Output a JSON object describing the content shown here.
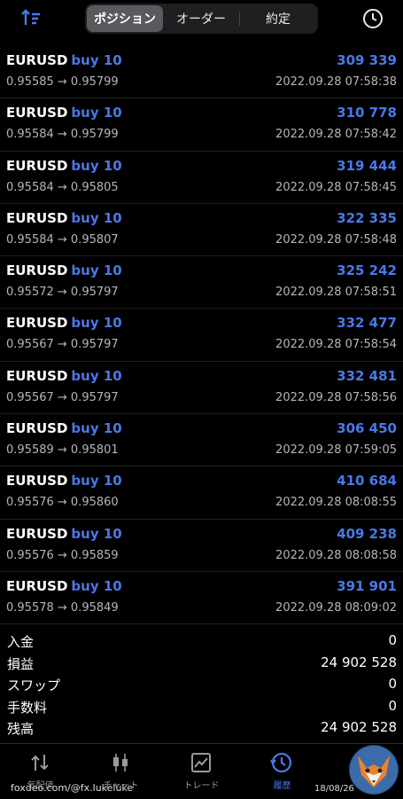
{
  "tabs": [
    {
      "label": "ポジション",
      "active": true
    },
    {
      "label": "オーダー",
      "active": false
    },
    {
      "label": "約定",
      "active": false
    }
  ],
  "icons": {
    "sort": "sort-arrows-icon",
    "history": "clock-icon"
  },
  "colors": {
    "accent": "#4a78e8",
    "background": "#000000"
  },
  "deals": [
    {
      "symbol": "EURUSD",
      "side": "buy 10",
      "profit": "309 339",
      "prices": "0.95585 → 0.95799",
      "time": "2022.09.28 07:58:38"
    },
    {
      "symbol": "EURUSD",
      "side": "buy 10",
      "profit": "310 778",
      "prices": "0.95584 → 0.95799",
      "time": "2022.09.28 07:58:42"
    },
    {
      "symbol": "EURUSD",
      "side": "buy 10",
      "profit": "319 444",
      "prices": "0.95584 → 0.95805",
      "time": "2022.09.28 07:58:45"
    },
    {
      "symbol": "EURUSD",
      "side": "buy 10",
      "profit": "322 335",
      "prices": "0.95584 → 0.95807",
      "time": "2022.09.28 07:58:48"
    },
    {
      "symbol": "EURUSD",
      "side": "buy 10",
      "profit": "325 242",
      "prices": "0.95572 → 0.95797",
      "time": "2022.09.28 07:58:51"
    },
    {
      "symbol": "EURUSD",
      "side": "buy 10",
      "profit": "332 477",
      "prices": "0.95567 → 0.95797",
      "time": "2022.09.28 07:58:54"
    },
    {
      "symbol": "EURUSD",
      "side": "buy 10",
      "profit": "332 481",
      "prices": "0.95567 → 0.95797",
      "time": "2022.09.28 07:58:56"
    },
    {
      "symbol": "EURUSD",
      "side": "buy 10",
      "profit": "306 450",
      "prices": "0.95589 → 0.95801",
      "time": "2022.09.28 07:59:05"
    },
    {
      "symbol": "EURUSD",
      "side": "buy 10",
      "profit": "410 684",
      "prices": "0.95576 → 0.95860",
      "time": "2022.09.28 08:08:55"
    },
    {
      "symbol": "EURUSD",
      "side": "buy 10",
      "profit": "409 238",
      "prices": "0.95576 → 0.95859",
      "time": "2022.09.28 08:08:58"
    },
    {
      "symbol": "EURUSD",
      "side": "buy 10",
      "profit": "391 901",
      "prices": "0.95578 → 0.95849",
      "time": "2022.09.28 08:09:02"
    }
  ],
  "summary": [
    {
      "label": "入金",
      "value": "0"
    },
    {
      "label": "損益",
      "value": "24 902 528"
    },
    {
      "label": "スワップ",
      "value": "0"
    },
    {
      "label": "手数料",
      "value": "0"
    },
    {
      "label": "残高",
      "value": "24 902 528"
    }
  ],
  "nav": [
    {
      "label": "気配値",
      "icon": "quotes-icon",
      "active": false
    },
    {
      "label": "チャート",
      "icon": "chart-icon",
      "active": false
    },
    {
      "label": "トレード",
      "icon": "trade-icon",
      "active": false
    },
    {
      "label": "履歴",
      "icon": "history-icon",
      "active": true
    },
    {
      "label": "",
      "icon": "messages-icon",
      "active": false
    }
  ],
  "watermark": "foxdeo.com/@fx.lukeluke",
  "overlay_date": "18/08/26"
}
